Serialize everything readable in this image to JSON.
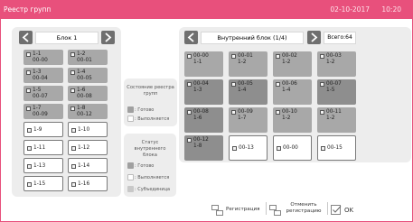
{
  "window": {
    "title": "Реестр групп",
    "date": "02-10-2017",
    "time": "10:20"
  },
  "left_panel": {
    "pager_label": "Блок 1",
    "tiles": [
      {
        "lines": [
          "1-1",
          "00-00"
        ],
        "state": "gray"
      },
      {
        "lines": [
          "1-2",
          "00-01"
        ],
        "state": "gray"
      },
      {
        "lines": [
          "1-3",
          "00-04"
        ],
        "state": "gray"
      },
      {
        "lines": [
          "1-4",
          "00-05"
        ],
        "state": "gray"
      },
      {
        "lines": [
          "1-5",
          "00-07"
        ],
        "state": "gray"
      },
      {
        "lines": [
          "1-6",
          "00-08"
        ],
        "state": "gray"
      },
      {
        "lines": [
          "1-7",
          "00-09"
        ],
        "state": "gray"
      },
      {
        "lines": [
          "1-8",
          "00-12"
        ],
        "state": "gray"
      },
      {
        "lines": [
          "1-9"
        ],
        "state": "white"
      },
      {
        "lines": [
          "1-10"
        ],
        "state": "white"
      },
      {
        "lines": [
          "1-11"
        ],
        "state": "white"
      },
      {
        "lines": [
          "1-12"
        ],
        "state": "white"
      },
      {
        "lines": [
          "1-13"
        ],
        "state": "white"
      },
      {
        "lines": [
          "1-14"
        ],
        "state": "white"
      },
      {
        "lines": [
          "1-15"
        ],
        "state": "white"
      },
      {
        "lines": [
          "1-16"
        ],
        "state": "white"
      }
    ]
  },
  "right_panel": {
    "pager_label": "Внутренний блок (1/4)",
    "total_label": "Всего:64",
    "tiles": [
      {
        "lines": [
          "00-00",
          "1-1"
        ],
        "state": "gray"
      },
      {
        "lines": [
          "00-01",
          "1-2"
        ],
        "state": "gray"
      },
      {
        "lines": [
          "00-02",
          "1-2"
        ],
        "state": "gray"
      },
      {
        "lines": [
          "00-03",
          "1-2"
        ],
        "state": "gray"
      },
      {
        "lines": [
          "00-04",
          "1-3"
        ],
        "state": "dark"
      },
      {
        "lines": [
          "00-05",
          "1-4"
        ],
        "state": "dark"
      },
      {
        "lines": [
          "00-06",
          "1-4"
        ],
        "state": "gray"
      },
      {
        "lines": [
          "00-07",
          "1-5"
        ],
        "state": "dark"
      },
      {
        "lines": [
          "00-08",
          "1-6"
        ],
        "state": "dark"
      },
      {
        "lines": [
          "00-09",
          "1-7"
        ],
        "state": "gray"
      },
      {
        "lines": [
          "00-10",
          "1-2"
        ],
        "state": "gray"
      },
      {
        "lines": [
          "00-11",
          "1-2"
        ],
        "state": "gray"
      },
      {
        "lines": [
          "00-12",
          "1-8"
        ],
        "state": "dark"
      },
      {
        "lines": [
          "00-13"
        ],
        "state": "white"
      },
      {
        "lines": [
          "00-00"
        ],
        "state": "white"
      },
      {
        "lines": [
          "00-15"
        ],
        "state": "white"
      }
    ]
  },
  "legend_registry": {
    "title": "Состояние реестра групп",
    "items": [
      {
        "label": ": Готово",
        "color": "#a0a0a0"
      },
      {
        "label": ": Выполняется",
        "color": "#ffffff"
      }
    ]
  },
  "legend_indoor": {
    "title": "Статус внутреннего блока",
    "items": [
      {
        "label": ": Готово",
        "color": "#a0a0a0"
      },
      {
        "label": ": Выполняется",
        "color": "#ffffff"
      },
      {
        "label": ": Субъединица",
        "color": "#c8c8c8"
      }
    ]
  },
  "bottom_bar": {
    "register_label": "Регистрация",
    "cancel_label_line1": "Отменить",
    "cancel_label_line2": "регистрацию",
    "ok_label": "OK"
  },
  "colors": {
    "accent": "#e8507c",
    "tile_gray": "#a8a8a8",
    "tile_dark": "#8e8e8e",
    "panel_bg": "#ededed"
  }
}
